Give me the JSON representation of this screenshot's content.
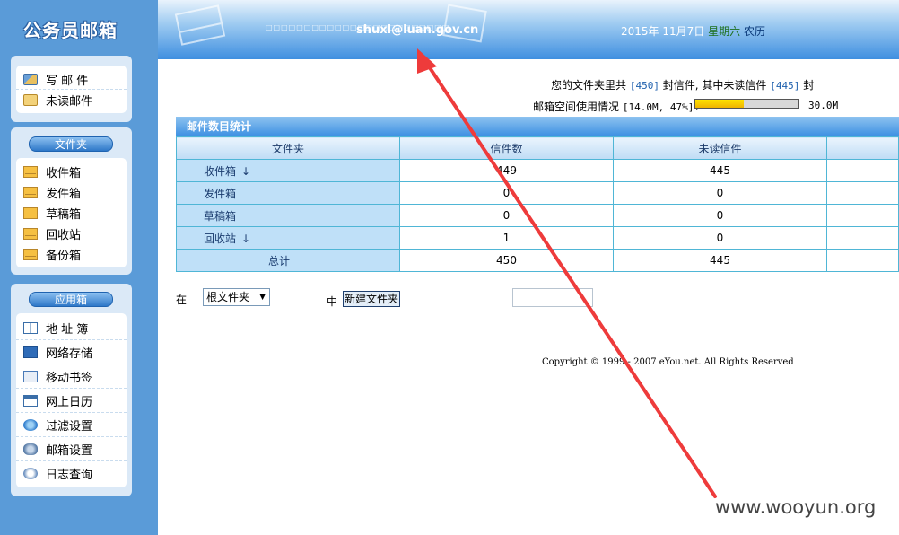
{
  "sidebar": {
    "logo": "公务员邮箱",
    "compose": {
      "write": "写 邮 件",
      "unread": "未读邮件"
    },
    "folders_header": "文件夹",
    "folders": [
      "收件箱",
      "发件箱",
      "草稿箱",
      "回收站",
      "备份箱"
    ],
    "apps_header": "应用箱",
    "apps": [
      "地 址 簿",
      "网络存储",
      "移动书签",
      "网上日历",
      "过滤设置",
      "邮箱设置",
      "日志查询"
    ]
  },
  "header": {
    "email": "shuxl@luan.gov.cn",
    "date": "2015年 11月7日",
    "weekday": "星期六",
    "calendar": "农历"
  },
  "summary": {
    "prefix": "您的文件夹里共",
    "total": "[450]",
    "mid": "封信件, 其中未读信件",
    "unread": "[445]",
    "suffix": "封",
    "quota_label": "邮箱空间使用情况",
    "quota_value": "[14.0M, 47%]:",
    "quota_percent": 47,
    "quota_max": "30.0M"
  },
  "stats": {
    "title": "邮件数目统计",
    "columns": [
      "文件夹",
      "信件数",
      "未读信件"
    ],
    "rows": [
      {
        "folder": "收件箱",
        "arrow": "↓",
        "count": "449",
        "unread": "445"
      },
      {
        "folder": "发件箱",
        "arrow": "",
        "count": "0",
        "unread": "0"
      },
      {
        "folder": "草稿箱",
        "arrow": "",
        "count": "0",
        "unread": "0"
      },
      {
        "folder": "回收站",
        "arrow": "↓",
        "count": "1",
        "unread": "0"
      }
    ],
    "total": {
      "label": "总计",
      "count": "450",
      "unread": "445"
    }
  },
  "create_folder": {
    "in_label": "在",
    "parent_value": "根文件夹",
    "mid_label": "中",
    "button": "新建文件夹"
  },
  "copyright": "Copyright © 1999 - 2007 eYou.net. All Rights Reserved",
  "watermark": "www.wooyun.org"
}
